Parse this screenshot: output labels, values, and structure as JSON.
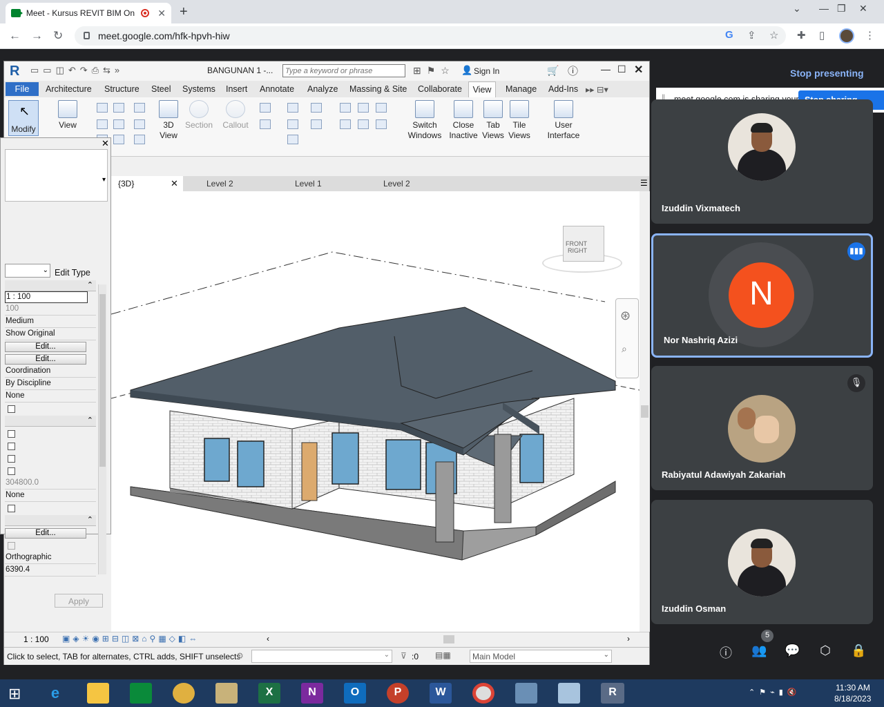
{
  "browser": {
    "tab_title": "Meet - Kursus REVIT BIM On",
    "url": "meet.google.com/hfk-hpvh-hiw",
    "new_tab": "+",
    "close_tab": "✕"
  },
  "revit": {
    "project_name": "BANGUNAN 1 -...",
    "search_placeholder": "Type a keyword or phrase",
    "sign_in": "Sign In",
    "menu": [
      "File",
      "Architecture",
      "Structure",
      "Steel",
      "Systems",
      "Insert",
      "Annotate",
      "Analyze",
      "Massing & Site",
      "Collaborate",
      "View",
      "Manage",
      "Add-Ins"
    ],
    "ribbon": {
      "modify": "Modify",
      "view": "View",
      "three_d_view_1": "3D",
      "three_d_view_2": "View",
      "section": "Section",
      "callout": "Callout",
      "switch_windows_1": "Switch",
      "switch_windows_2": "Windows",
      "close_inactive_1": "Close",
      "close_inactive_2": "Inactive",
      "tab_views_1": "Tab",
      "tab_views_2": "Views",
      "tile_views_1": "Tile",
      "tile_views_2": "Views",
      "user_interface_1": "User",
      "user_interface_2": "Interface"
    },
    "properties": {
      "edit_type": "Edit Type",
      "apply": "Apply",
      "rows": {
        "scale": "1 : 100",
        "scale_value": "100",
        "detail": "Medium",
        "parts": "Show Original",
        "vg": "Edit...",
        "graphics": "Edit...",
        "discipline": "Coordination",
        "color_scheme": "By Discipline",
        "default_analysis": "None",
        "crop_value": "304800.0",
        "annotation": "None",
        "camera_edit": "Edit...",
        "projection": "Orthographic",
        "eye_elev": "6390.4"
      }
    },
    "view_tabs": [
      "{3D}",
      "Level 2",
      "Level 1",
      "Level 2"
    ],
    "viewcube": {
      "front": "FRONT",
      "right": "RIGHT"
    },
    "view_scale": "1 : 100",
    "status_text": "Click to select, TAB for alternates, CTRL adds, SHIFT unselects",
    "selection_count": ":0",
    "model": "Main Model"
  },
  "meet": {
    "stop_presenting": "Stop presenting",
    "share_notice": "meet.google.com is sharing your screen.",
    "stop_sharing": "Stop sharing",
    "participants": [
      {
        "name": "Izuddin Vixmatech",
        "type": "photo"
      },
      {
        "name": "Nor Nashriq Azizi",
        "type": "initial",
        "initial": "N",
        "speaking": true
      },
      {
        "name": "Rabiyatul Adawiyah Zakariah",
        "type": "photo",
        "muted": true
      },
      {
        "name": "Izuddin Osman",
        "type": "photo"
      }
    ],
    "participant_count": "5",
    "colors": {
      "accent": "#8ab4f8",
      "avatar_n": "#f4511e",
      "tile": "#3c4043"
    }
  },
  "taskbar": {
    "time": "11:30 AM",
    "date": "8/18/2023"
  }
}
